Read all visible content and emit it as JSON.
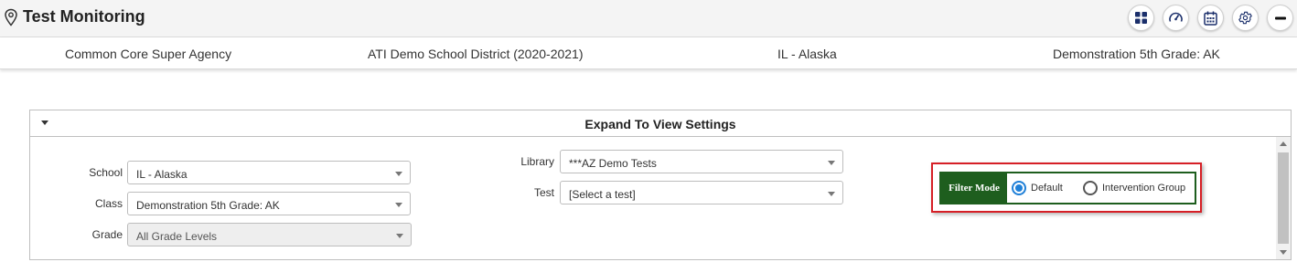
{
  "header": {
    "title": "Test Monitoring",
    "pin_icon": "map-pin-icon",
    "actions": [
      {
        "name": "dashboard-grid-button",
        "icon": "grid-icon"
      },
      {
        "name": "speedometer-button",
        "icon": "speedometer-icon"
      },
      {
        "name": "calendar-button",
        "icon": "calendar-icon"
      },
      {
        "name": "settings-button",
        "icon": "gear-icon"
      },
      {
        "name": "minimize-button",
        "icon": "minus-icon"
      }
    ]
  },
  "context": {
    "agency": "Common Core Super Agency",
    "district": "ATI Demo School District (2020-2021)",
    "school": "IL - Alaska",
    "class": "Demonstration 5th Grade: AK"
  },
  "settings_panel": {
    "title": "Expand To View Settings",
    "school": {
      "label": "School",
      "value": "IL - Alaska"
    },
    "class": {
      "label": "Class",
      "value": "Demonstration 5th Grade: AK"
    },
    "grade": {
      "label": "Grade",
      "value": "All Grade Levels"
    },
    "library": {
      "label": "Library",
      "value": "***AZ Demo Tests"
    },
    "test": {
      "label": "Test",
      "value": "[Select a test]"
    },
    "filter_mode": {
      "label": "Filter Mode",
      "options": [
        "Default",
        "Intervention Group"
      ],
      "selected": "Default"
    }
  },
  "colors": {
    "filter_green": "#1e5e1e",
    "highlight_red": "#d61f26",
    "radio_blue": "#1f80d8",
    "icon_navy": "#1b2f6b"
  }
}
